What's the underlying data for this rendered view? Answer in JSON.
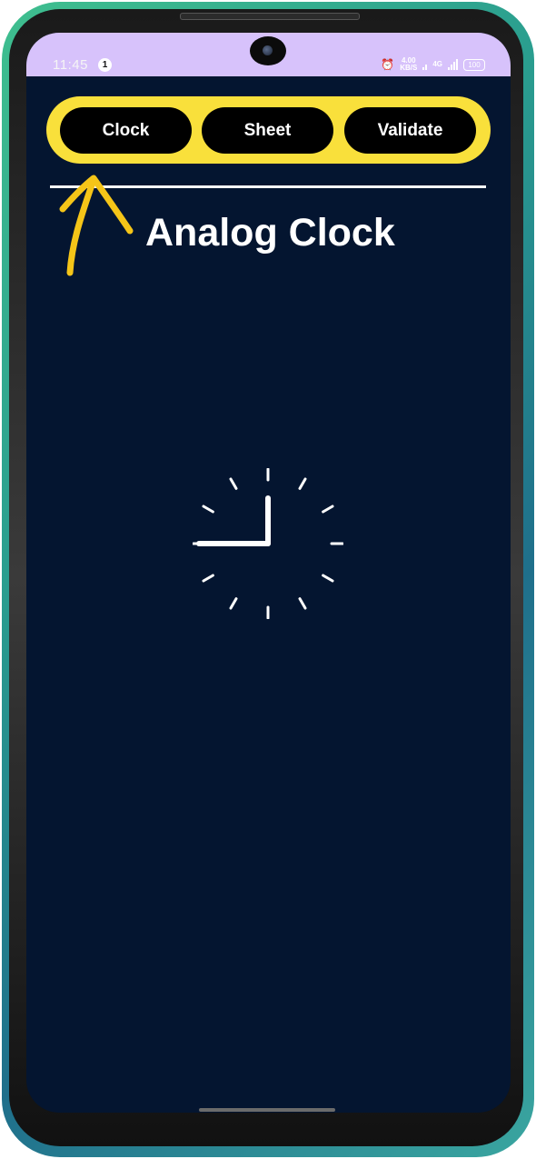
{
  "status_bar": {
    "time": "11:45",
    "notification_count": "1",
    "speed_value": "4.00",
    "speed_unit": "KB/S",
    "network_type": "4G",
    "battery": "100"
  },
  "tabs": [
    {
      "label": "Clock"
    },
    {
      "label": "Sheet"
    },
    {
      "label": "Validate"
    }
  ],
  "page": {
    "title": "Analog Clock"
  },
  "clock": {
    "hour": 9,
    "minute": 0
  },
  "colors": {
    "background": "#041530",
    "tab_bar": "#f9e03b",
    "tab": "#000000",
    "status_bar": "#d7c2fb",
    "annotation_arrow": "#f5c518"
  }
}
